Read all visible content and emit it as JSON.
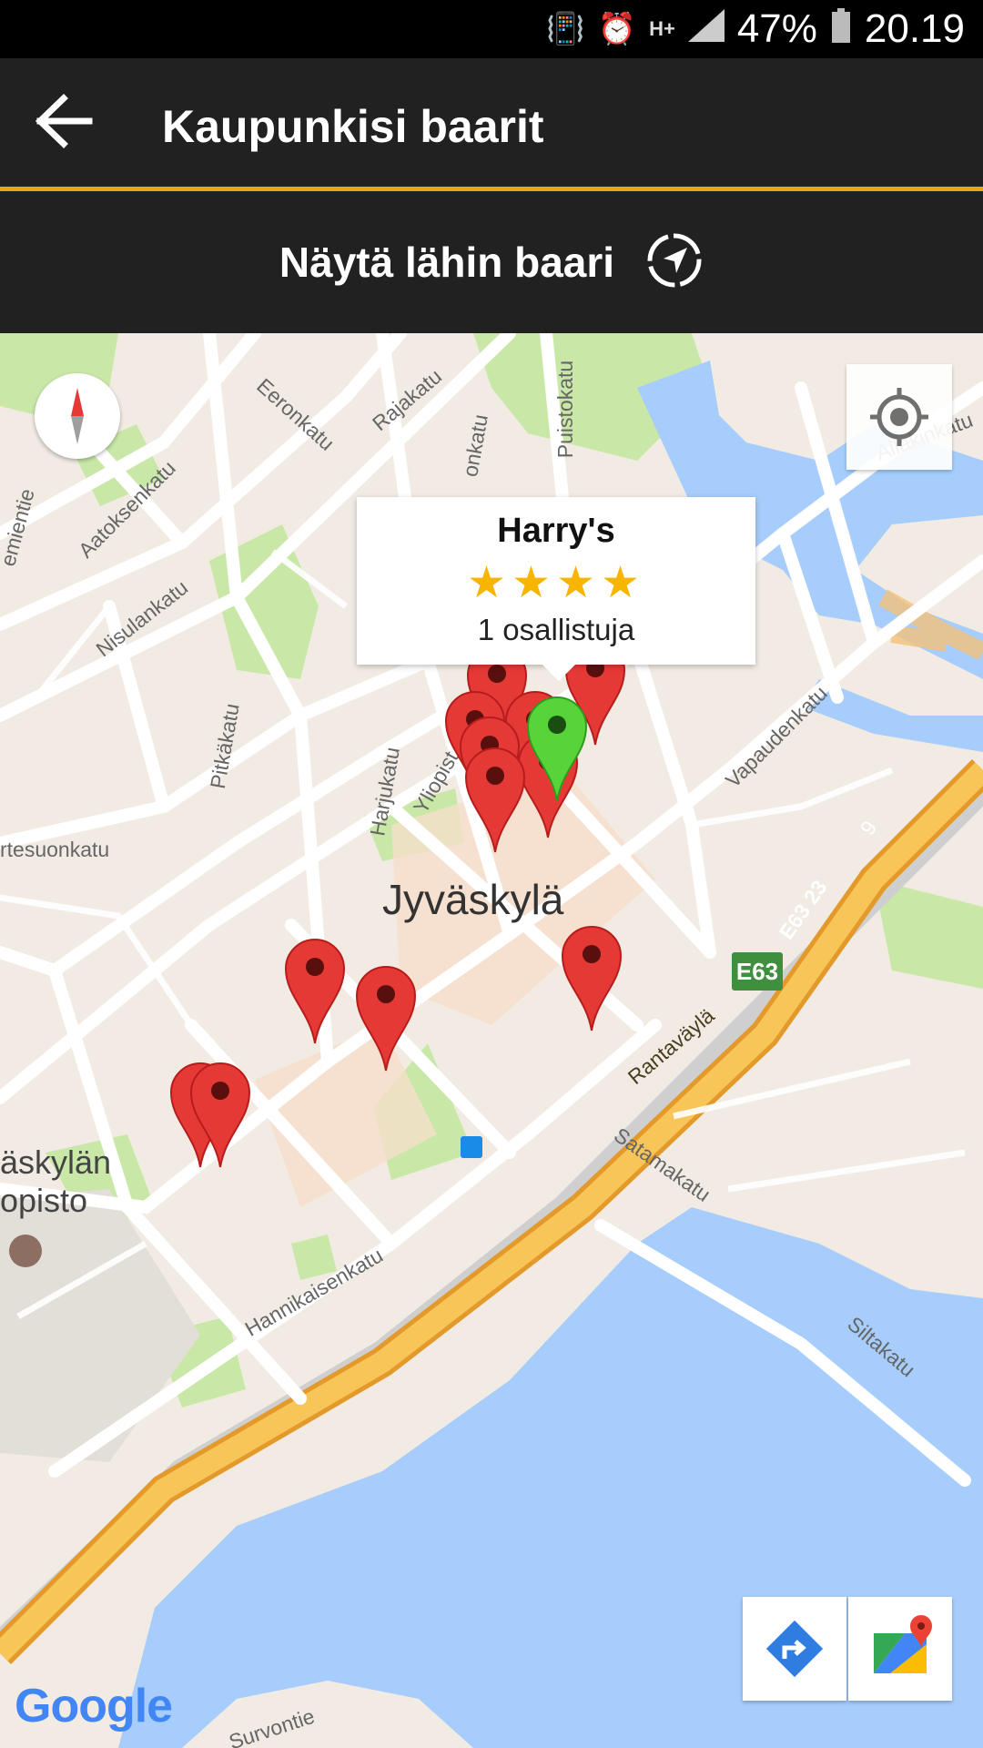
{
  "status_bar": {
    "battery": "47%",
    "time": "20.19",
    "network": "H+",
    "icons": [
      "vibrate-icon",
      "alarm-icon",
      "network-icon",
      "signal-icon",
      "battery-icon"
    ]
  },
  "app_bar": {
    "title": "Kaupunkisi baarit",
    "back_icon": "arrow-left-icon"
  },
  "nearest": {
    "label": "Näytä lähin baari",
    "icon": "navigation-compass-icon"
  },
  "map": {
    "city_label": "Jyväskylä",
    "university_label_line1": "äskylän",
    "university_label_line2": "opisto",
    "street_labels": [
      "Eeronkatu",
      "Rajakatu",
      "onkatu",
      "Puistokatu",
      "Aatoksenkatu",
      "emientie",
      "Nisulankatu",
      "Pitkäkatu",
      "Harjukatu",
      "Yliopist",
      "rtesuonkatu",
      "Vapaudenkatu",
      "Rantaväylä",
      "Satamakatu",
      "Hannikaisenkatu",
      "Siltakatu",
      "Survontie",
      "Ailakinkatu"
    ],
    "road_shield": "E63",
    "road_label": "E63 23",
    "road_number": "9",
    "attribution": "Google",
    "info_window": {
      "name": "Harry's",
      "rating": 4,
      "stars": "★★★★",
      "participants": "1 osallistuja"
    },
    "colors": {
      "land": "#f2ebe4",
      "park": "#c9e8a8",
      "water": "#a6cdfb",
      "highway": "#f6b53b",
      "marker_red": "#e53935",
      "marker_green": "#57d43a",
      "accent": "#f0a019"
    }
  }
}
